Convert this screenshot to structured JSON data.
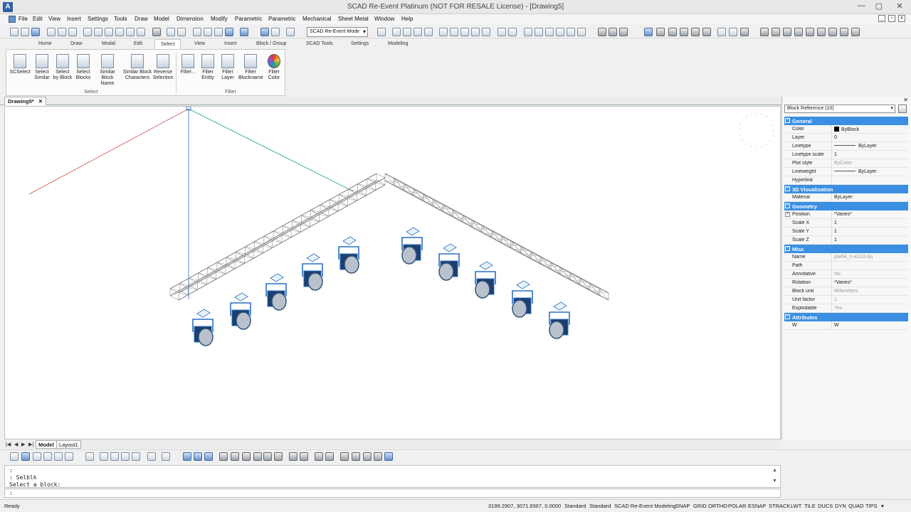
{
  "window": {
    "title": "SCAD Re-Event Platinum (NOT FOR RESALE License) - [Drawing5]",
    "app_icon": "A",
    "minimize": "—",
    "maximize": "▢",
    "close": "✕"
  },
  "menu": [
    "File",
    "Edit",
    "View",
    "Insert",
    "Settings",
    "Tools",
    "Draw",
    "Model",
    "Dimension",
    "Modify",
    "Parametric",
    "Parametric",
    "Mechanical",
    "Sheet Metal",
    "Window",
    "Help"
  ],
  "toolbar": {
    "mode_select": "SCAD Re-Event Mode"
  },
  "ribbon": {
    "tabs": [
      "Home",
      "Draw",
      "Modal",
      "Edit",
      "Select",
      "View",
      "Insert",
      "Block / Group",
      "SCAD Tools",
      "Settings",
      "Modeling"
    ],
    "active_tab": "Select",
    "select_group": {
      "label": "Select",
      "buttons": [
        {
          "label1": "SCSelect",
          "label2": ""
        },
        {
          "label1": "Select",
          "label2": "Similar"
        },
        {
          "label1": "Select",
          "label2": "by Block"
        },
        {
          "label1": "Select",
          "label2": "Blocks"
        },
        {
          "label1": "Similar",
          "label2": "Block Name"
        },
        {
          "label1": "Similar Block",
          "label2": "Characters"
        },
        {
          "label1": "Reverse",
          "label2": "Selection"
        }
      ]
    },
    "filter_group": {
      "label": "Filter",
      "buttons": [
        {
          "label1": "Filter...",
          "label2": ""
        },
        {
          "label1": "Filter",
          "label2": "Entity"
        },
        {
          "label1": "Filter",
          "label2": "Layer"
        },
        {
          "label1": "Filter",
          "label2": "Blockname"
        },
        {
          "label1": "Filter",
          "label2": "Color"
        }
      ]
    }
  },
  "document_tab": {
    "label": "Drawing5*",
    "close": "✕"
  },
  "layout_tabs": {
    "nav": [
      "|◀",
      "◀",
      "▶",
      "▶|"
    ],
    "model": "Model",
    "layout": "Layout1"
  },
  "command_window": {
    "lines": [
      ":",
      ": Selblk",
      "Select a block:"
    ],
    "prompt": ":"
  },
  "status": {
    "ready": "Ready",
    "coords": "3199.2907, 3071.9367, 0.0000",
    "items": [
      "Standard",
      "Standard",
      "SCAD Re-Event Modeling",
      "SNAP",
      "GRID",
      "ORTHO",
      "POLAR",
      "ESNAP",
      "STRACK",
      "LWT",
      "TILE",
      "DUCS",
      "DYN",
      "QUAD",
      "TIPS"
    ]
  },
  "properties": {
    "selection": "Block Reference (10)",
    "close": "✕",
    "sections": [
      {
        "title": "General",
        "rows": [
          {
            "k": "Color",
            "v": "ByBlock",
            "swatch": "#000000"
          },
          {
            "k": "Layer",
            "v": "0"
          },
          {
            "k": "Linetype",
            "v": "ByLayer",
            "line": true
          },
          {
            "k": "Linetype scale",
            "v": "1"
          },
          {
            "k": "Plot style",
            "v": "ByColor",
            "dim": true
          },
          {
            "k": "Lineweight",
            "v": "ByLayer",
            "line": true
          },
          {
            "k": "Hyperlink",
            "v": ""
          }
        ]
      },
      {
        "title": "3D Visualization",
        "rows": [
          {
            "k": "Material",
            "v": "ByLayer"
          }
        ]
      },
      {
        "title": "Geometry",
        "rows": [
          {
            "k": "Position",
            "v": "*Varies*",
            "toggle": true
          },
          {
            "k": "Scale X",
            "v": "1"
          },
          {
            "k": "Scale Y",
            "v": "1"
          },
          {
            "k": "Scale Z",
            "v": "1"
          }
        ]
      },
      {
        "title": "Misc",
        "rows": [
          {
            "k": "Name",
            "v": "par64_z-w110-3q",
            "dim": true
          },
          {
            "k": "Path",
            "v": ""
          },
          {
            "k": "Annotative",
            "v": "No",
            "dim": true
          },
          {
            "k": "Rotation",
            "v": "*Varies*"
          },
          {
            "k": "Block unit",
            "v": "Millimeters",
            "dim": true
          },
          {
            "k": "Unit factor",
            "v": "1",
            "dim": true
          },
          {
            "k": "Explodable",
            "v": "Yes",
            "dim": true
          }
        ]
      },
      {
        "title": "Attributes",
        "rows": [
          {
            "k": "W",
            "v": "W"
          }
        ]
      }
    ]
  },
  "colors": {
    "accent": "#3b8fe2",
    "truss": "#8a8a8a",
    "fixture": "#2a6fc4"
  }
}
